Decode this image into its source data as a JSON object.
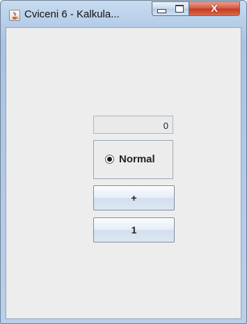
{
  "window": {
    "title": "Cviceni 6 - Kalkula...",
    "icons": {
      "app": "java-cup-icon",
      "minimize": "minimize-icon",
      "maximize": "maximize-icon",
      "close": "close-icon"
    },
    "close_glyph": "X"
  },
  "calculator": {
    "display_value": "0",
    "mode_label": "Normal",
    "mode_selected": true,
    "plus_label": "+",
    "one_label": "1"
  }
}
